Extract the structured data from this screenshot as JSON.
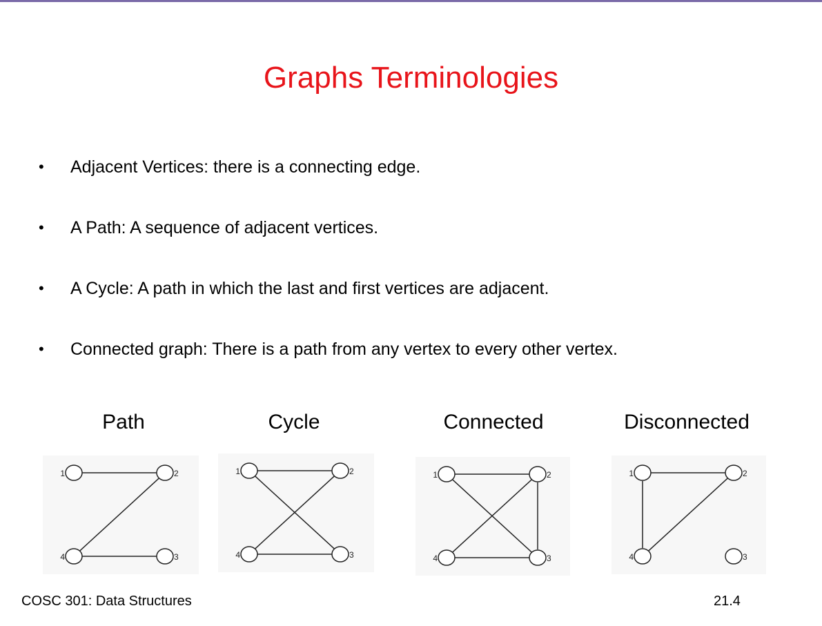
{
  "slide": {
    "title": "Graphs Terminologies",
    "bullets": [
      "Adjacent Vertices: there is a connecting edge.",
      "A Path: A sequence of adjacent vertices.",
      "A Cycle: A path in which the last and first vertices are adjacent.",
      "Connected graph: There is a path from any vertex to every other vertex."
    ],
    "bullet_symbol": "•",
    "footer_left": "COSC 301: Data Structures",
    "footer_right": "21.4"
  },
  "graphs": [
    {
      "label": "Path",
      "vertices": [
        "1",
        "2",
        "3",
        "4"
      ],
      "edges": [
        [
          "1",
          "2"
        ],
        [
          "2",
          "4"
        ],
        [
          "4",
          "3"
        ]
      ]
    },
    {
      "label": "Cycle",
      "vertices": [
        "1",
        "2",
        "3",
        "4"
      ],
      "edges": [
        [
          "1",
          "2"
        ],
        [
          "1",
          "3"
        ],
        [
          "2",
          "4"
        ],
        [
          "4",
          "3"
        ]
      ]
    },
    {
      "label": "Connected",
      "vertices": [
        "1",
        "2",
        "3",
        "4"
      ],
      "edges": [
        [
          "1",
          "2"
        ],
        [
          "1",
          "3"
        ],
        [
          "2",
          "4"
        ],
        [
          "2",
          "3"
        ],
        [
          "4",
          "3"
        ]
      ]
    },
    {
      "label": "Disconnected",
      "vertices": [
        "1",
        "2",
        "3",
        "4"
      ],
      "edges": [
        [
          "1",
          "2"
        ],
        [
          "1",
          "4"
        ],
        [
          "2",
          "4"
        ]
      ]
    }
  ]
}
